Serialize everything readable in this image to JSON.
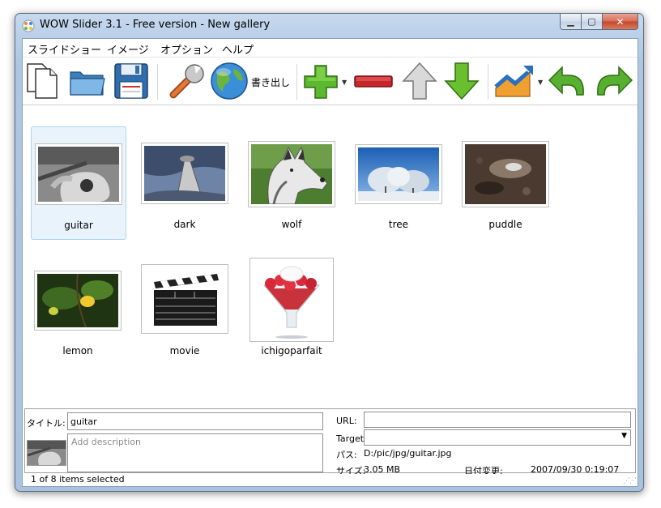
{
  "window": {
    "title": "WOW Slider 3.1 - Free version - New gallery"
  },
  "menu": [
    "スライドショー",
    "イメージ",
    "オプション",
    "ヘルプ"
  ],
  "toolbar": {
    "export_label": "書き出し"
  },
  "gallery": {
    "items": [
      {
        "caption": "guitar",
        "selected": true
      },
      {
        "caption": "dark",
        "selected": false
      },
      {
        "caption": "wolf",
        "selected": false
      },
      {
        "caption": "tree",
        "selected": false
      },
      {
        "caption": "puddle",
        "selected": false
      },
      {
        "caption": "lemon",
        "selected": false
      },
      {
        "caption": "movie",
        "selected": false
      },
      {
        "caption": "ichigoparfait",
        "selected": false
      }
    ]
  },
  "properties": {
    "title_label": "タイトル:",
    "title_value": "guitar",
    "description_placeholder": "Add description",
    "url_label": "URL:",
    "url_value": "",
    "target_label": "Target",
    "target_value": "",
    "path_label": "パス:",
    "path_value": "D:/pic/jpg/guitar.jpg",
    "size_label": "サイズ:",
    "size_value": "3.05 MB",
    "date_label": "日付変更:",
    "date_value": "2007/09/30 0:19:07"
  },
  "status": {
    "text": "1 of 8 items selected"
  }
}
